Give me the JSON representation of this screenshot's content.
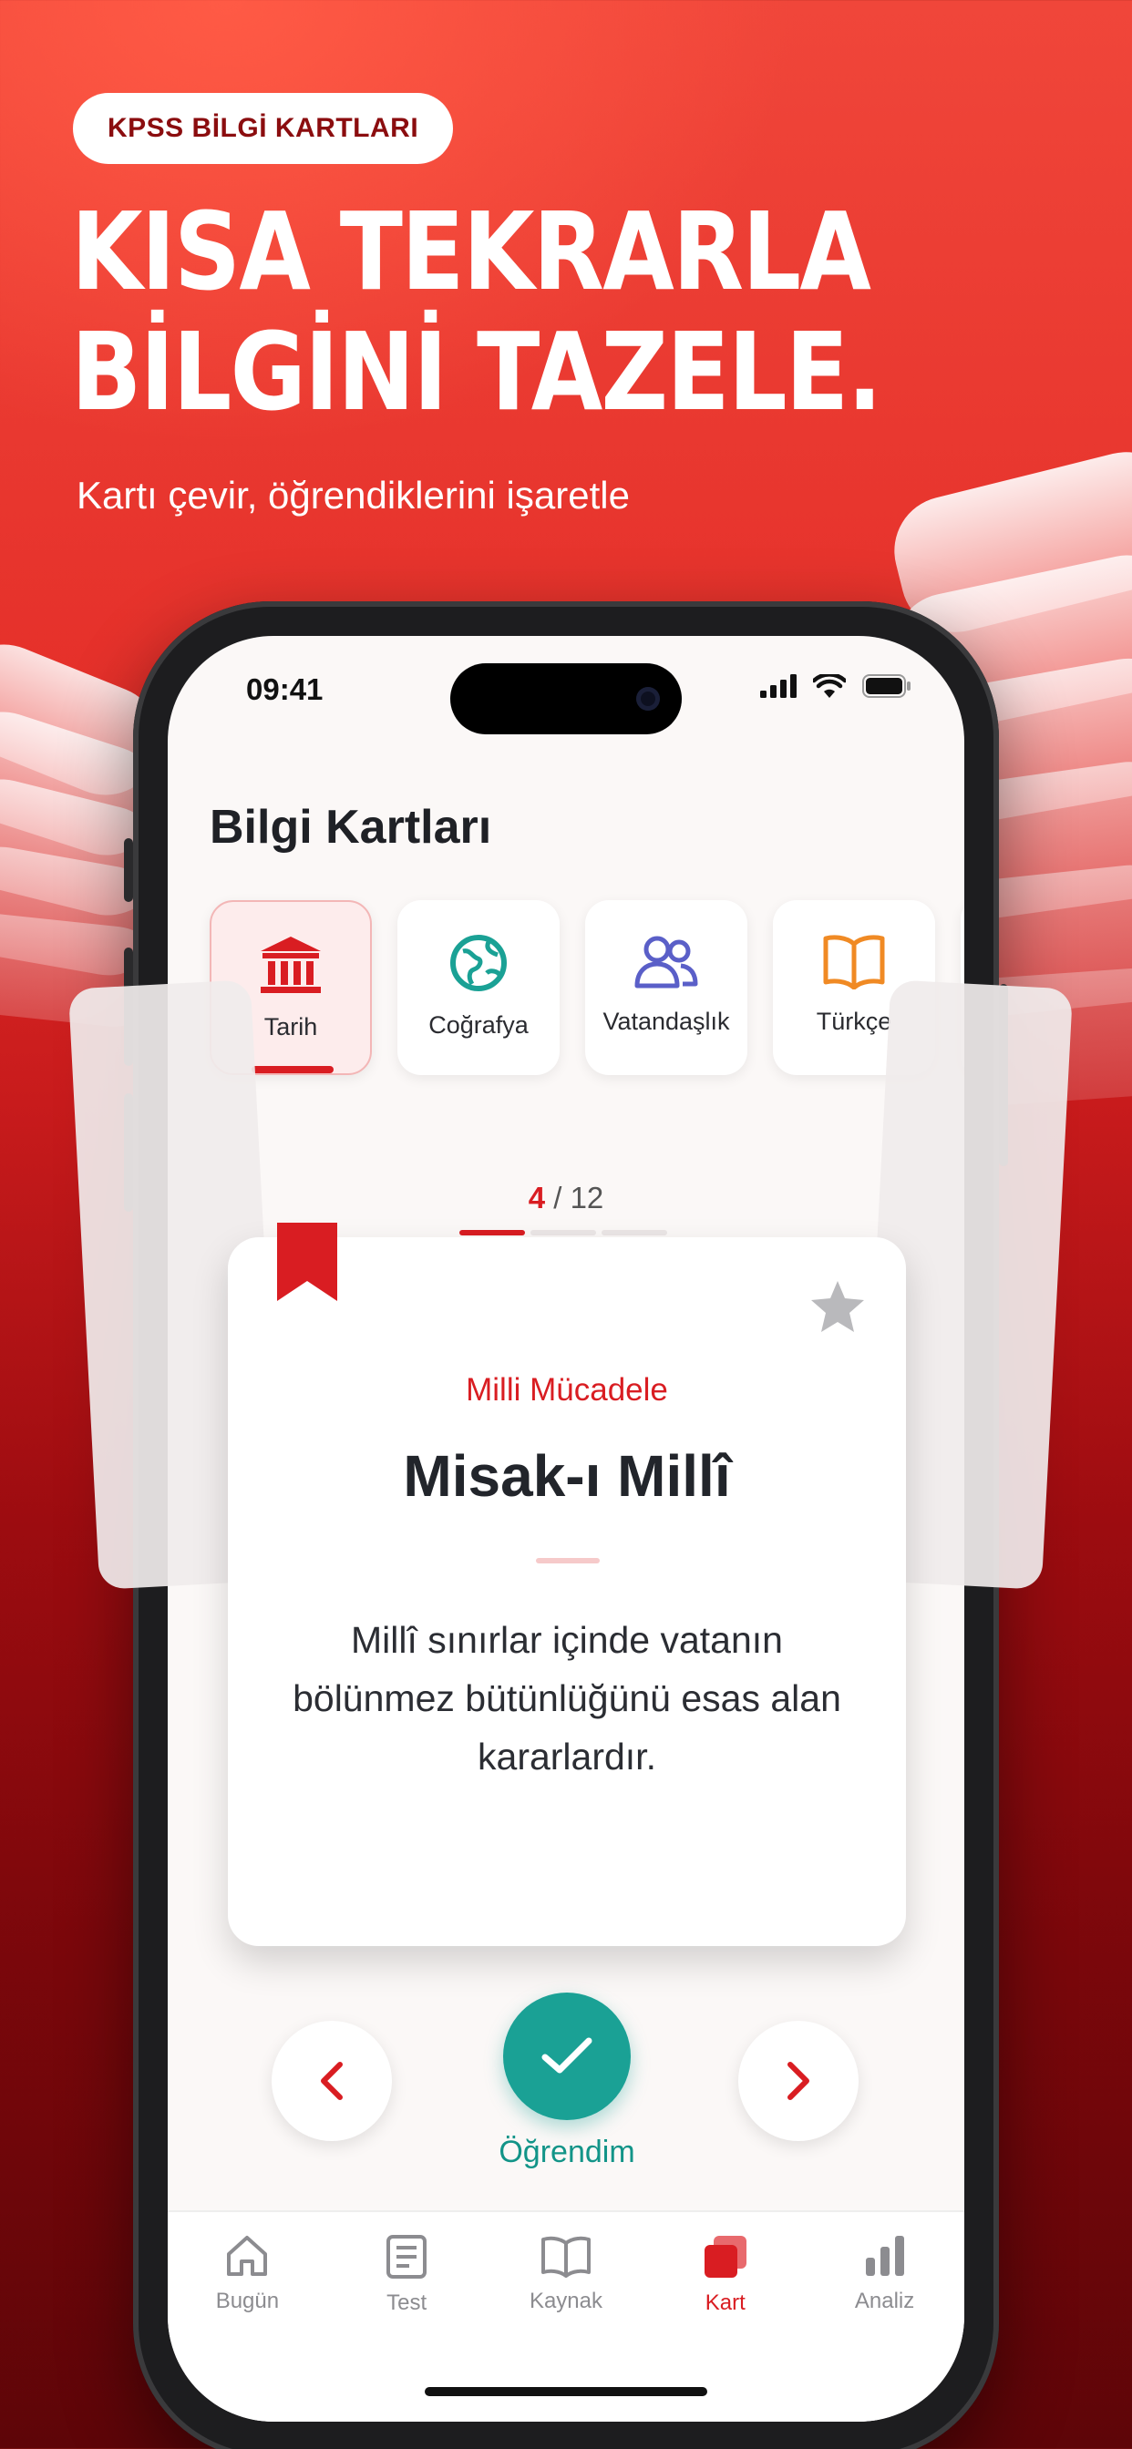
{
  "promo": {
    "badge": "KPSS BİLGİ KARTLARI",
    "headline_line1": "KISA TEKRARLA",
    "headline_line2": "BİLGİNİ TAZELE.",
    "subtitle": "Kartı çevir, öğrendiklerini işaretle"
  },
  "status_bar": {
    "time": "09:41",
    "icons": [
      "signal-icon",
      "wifi-icon",
      "battery-icon"
    ]
  },
  "screen": {
    "title": "Bilgi Kartları"
  },
  "categories": [
    {
      "label": "Tarih",
      "icon": "museum-icon",
      "color": "#d91d22",
      "selected": true
    },
    {
      "label": "Coğrafya",
      "icon": "globe-icon",
      "color": "#1aa195",
      "selected": false
    },
    {
      "label": "Vatandaşlık",
      "icon": "users-icon",
      "color": "#5a5fc8",
      "selected": false
    },
    {
      "label": "Türkçe",
      "icon": "book-open-icon",
      "color": "#f08a24",
      "selected": false
    }
  ],
  "counter": {
    "current": "4",
    "total": "/ 12"
  },
  "progress": {
    "filled_segments": 1,
    "total_segments": 3
  },
  "card": {
    "category": "Milli Mücadele",
    "term": "Misak-ı Millî",
    "definition": "Millî sınırlar içinde vatanın bölünmez bütünlüğünü esas alan kararlardır."
  },
  "actions": {
    "learned_label": "Öğrendim",
    "learned_color": "#1aa195",
    "prev_icon": "chevron-left-icon",
    "next_icon": "chevron-right-icon"
  },
  "tabbar": [
    {
      "label": "Bugün",
      "icon": "home-icon",
      "active": false
    },
    {
      "label": "Test",
      "icon": "document-icon",
      "active": false
    },
    {
      "label": "Kaynak",
      "icon": "book-icon",
      "active": false
    },
    {
      "label": "Kart",
      "icon": "cards-icon",
      "active": true
    },
    {
      "label": "Analiz",
      "icon": "bar-chart-icon",
      "active": false
    }
  ],
  "colors": {
    "accent": "#d91d22",
    "teal": "#1aa195",
    "background_red": "#c81b1c"
  }
}
